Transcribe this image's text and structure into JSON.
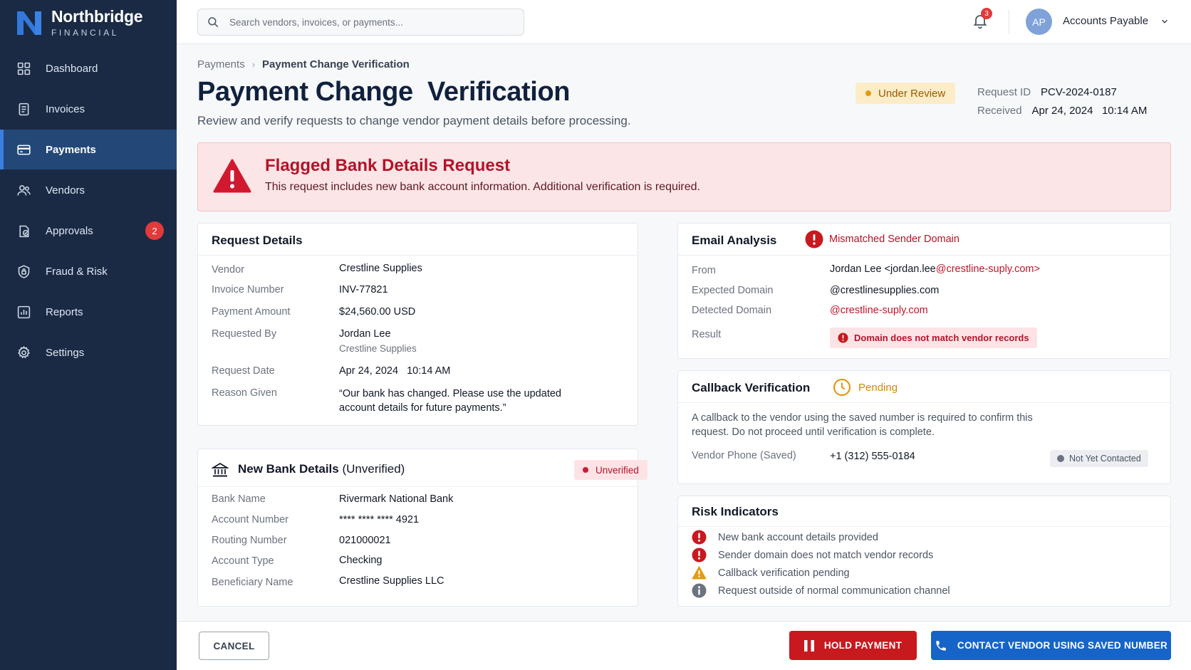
{
  "app": {
    "brand_name": "Northbridge",
    "brand_sub": "FINANCIAL"
  },
  "sidebar": {
    "items": [
      {
        "label": "Dashboard",
        "icon": "grid-icon"
      },
      {
        "label": "Invoices",
        "icon": "document-icon"
      },
      {
        "label": "Payments",
        "icon": "credit-card-icon",
        "active": true
      },
      {
        "label": "Vendors",
        "icon": "users-icon"
      },
      {
        "label": "Approvals",
        "icon": "approval-check-icon",
        "badge": "2"
      },
      {
        "label": "Fraud & Risk",
        "icon": "shield-lock-icon"
      },
      {
        "label": "Reports",
        "icon": "bar-chart-icon"
      },
      {
        "label": "Settings",
        "icon": "gear-icon"
      }
    ]
  },
  "topbar": {
    "search_placeholder": "Search vendors, invoices, or payments...",
    "notifications_count": "3",
    "avatar_initials": "AP",
    "user_name": "Accounts Payable"
  },
  "breadcrumb": {
    "parent": "Payments",
    "current": "Payment Change Verification"
  },
  "page": {
    "title": "Payment Change  Verification",
    "subtitle": "Review and verify requests to change vendor payment details before processing.",
    "status": "Under Review",
    "request_id_label": "Request ID",
    "request_id": "PCV-2024-0187",
    "received_label": "Received",
    "received": "Apr 24, 2024   10:14 AM"
  },
  "alert": {
    "title": "Flagged Bank Details Request",
    "text": "This request includes new bank account information. Additional verification is required."
  },
  "request_details": {
    "title": "Request Details",
    "vendor_label": "Vendor",
    "vendor": "Crestline Supplies",
    "invoice_label": "Invoice Number",
    "invoice": "INV-77821",
    "amount_label": "Payment Amount",
    "amount": "$24,560.00 USD",
    "requested_by_label": "Requested By",
    "requested_by": "Jordan Lee",
    "requested_by_company": "Crestline Supplies",
    "date_label": "Request Date",
    "date": "Apr 24, 2024   10:14 AM",
    "reason_label": "Reason Given",
    "reason_line1": "“Our bank has changed. Please use the updated",
    "reason_line2": "account details for future payments.”"
  },
  "bank_details": {
    "title": "New Bank Details",
    "title_suffix": "(Unverified)",
    "tag": "Unverified",
    "bank_name_label": "Bank Name",
    "bank_name": "Rivermark National Bank",
    "account_label": "Account Number",
    "account": "**** **** **** 4921",
    "routing_label": "Routing Number",
    "routing": "021000021",
    "type_label": "Account Type",
    "type": "Checking",
    "beneficiary_label": "Beneficiary Name",
    "beneficiary": "Crestline Supplies LLC"
  },
  "email_analysis": {
    "title": "Email Analysis",
    "flag": "Mismatched Sender Domain",
    "from_label": "From",
    "from_name": "Jordan Lee <jordan.lee",
    "from_domain": "@crestline-suply.com>",
    "expected_label": "Expected Domain",
    "expected": "@crestlinesupplies.com",
    "detected_label": "Detected Domain",
    "detected": "@crestline-suply.com",
    "result_label": "Result",
    "result": "Domain does not match vendor records"
  },
  "callback": {
    "title": "Callback Verification",
    "status": "Pending",
    "text": "A callback to the vendor using the saved number is required to confirm this request. Do not proceed until verification is complete.",
    "phone_label": "Vendor Phone (Saved)",
    "phone": "+1 (312) 555-0184",
    "contact_status": "Not Yet Contacted"
  },
  "risk": {
    "title": "Risk Indicators",
    "items": [
      {
        "text": "New bank account details provided",
        "level": "error",
        "color": "#c8191f"
      },
      {
        "text": "Sender domain does not match vendor records",
        "level": "error",
        "color": "#c8191f"
      },
      {
        "text": "Callback verification pending",
        "level": "warning",
        "color": "#e39a14"
      },
      {
        "text": "Request outside of normal communication channel",
        "level": "info",
        "color": "#6b7280"
      }
    ]
  },
  "footer": {
    "cancel": "CANCEL",
    "hold": "HOLD PAYMENT",
    "contact": "CONTACT VENDOR USING SAVED NUMBER"
  },
  "colors": {
    "sidebar_bg": "#1a2a44",
    "active_nav": "#234877",
    "danger": "#c8191f",
    "primary": "#1664c8",
    "warning": "#e39a14"
  }
}
